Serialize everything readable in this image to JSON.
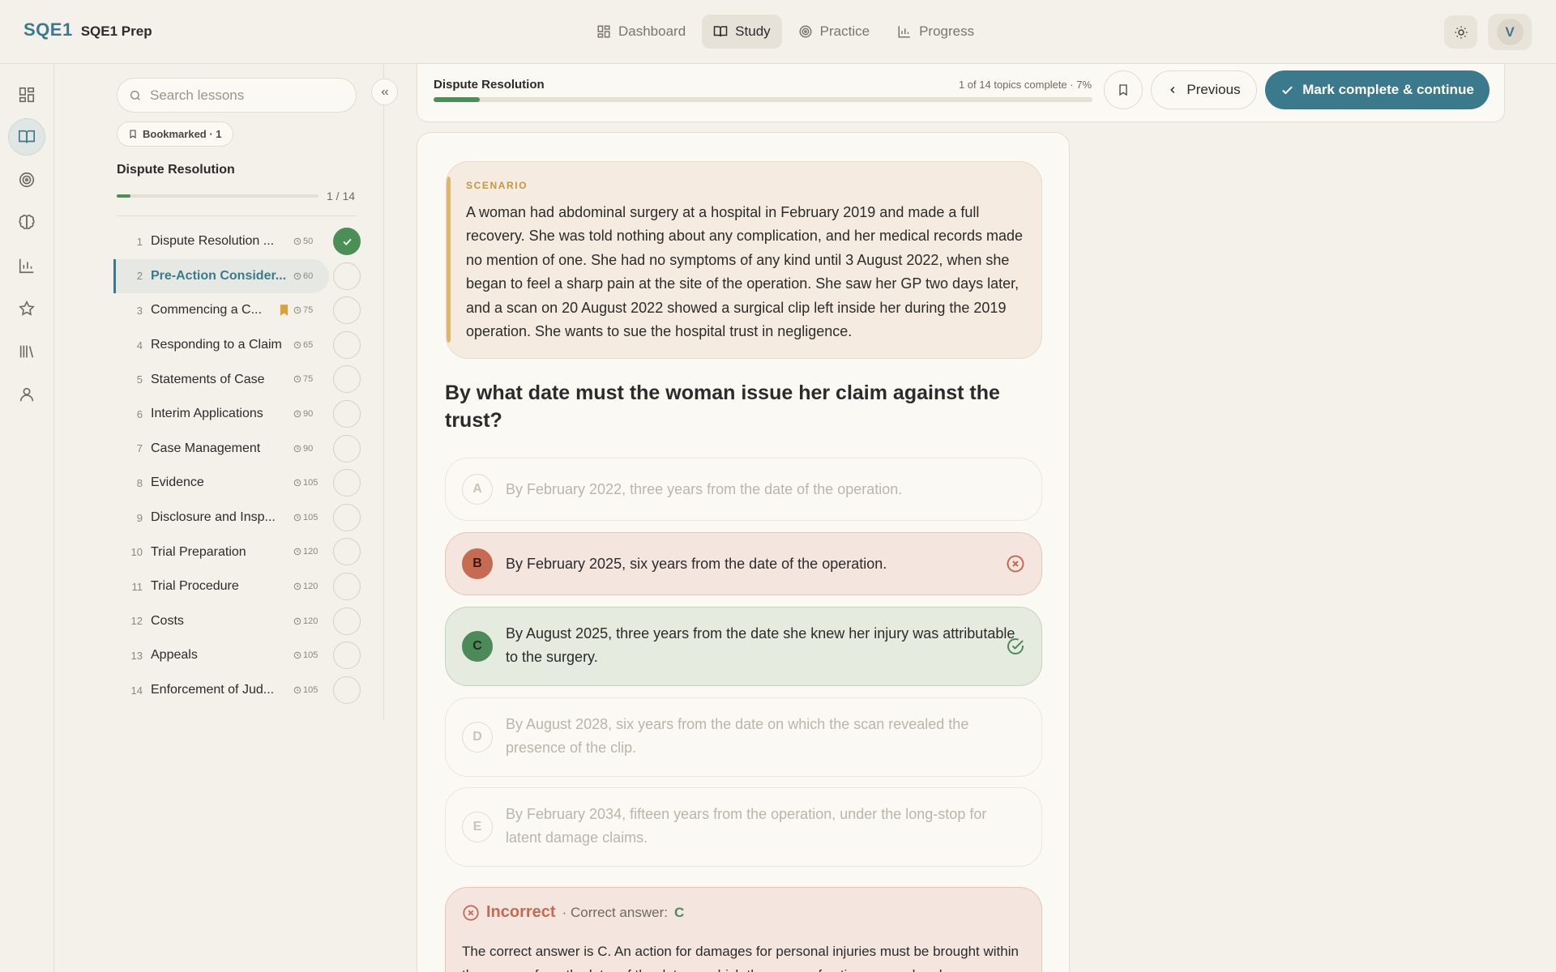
{
  "brand": {
    "mark": "SQE1",
    "name": "SQE1 Prep"
  },
  "nav": [
    {
      "label": "Dashboard",
      "icon": "dashboard-icon",
      "active": false
    },
    {
      "label": "Study",
      "icon": "book-icon",
      "active": true
    },
    {
      "label": "Practice",
      "icon": "target-icon",
      "active": false
    },
    {
      "label": "Progress",
      "icon": "chart-icon",
      "active": false
    }
  ],
  "user": {
    "initial": "V"
  },
  "rail": [
    "dashboard-icon",
    "book-icon",
    "target-icon",
    "brain-icon",
    "chart-icon",
    "star-icon",
    "library-icon",
    "user-icon"
  ],
  "sidebar": {
    "search_placeholder": "Search lessons",
    "bookmark_chip": "Bookmarked · 1",
    "section_title": "Dispute Resolution",
    "section_count": "1 / 14",
    "section_progress": 0.07,
    "lessons": [
      {
        "num": "1",
        "title": "Dispute Resolution ...",
        "time": "50",
        "done": true,
        "active": false,
        "bookmarked": false
      },
      {
        "num": "2",
        "title": "Pre-Action Consider...",
        "time": "60",
        "done": false,
        "active": true,
        "bookmarked": false
      },
      {
        "num": "3",
        "title": "Commencing a C...",
        "time": "75",
        "done": false,
        "active": false,
        "bookmarked": true
      },
      {
        "num": "4",
        "title": "Responding to a Claim",
        "time": "65",
        "done": false,
        "active": false,
        "bookmarked": false
      },
      {
        "num": "5",
        "title": "Statements of Case",
        "time": "75",
        "done": false,
        "active": false,
        "bookmarked": false
      },
      {
        "num": "6",
        "title": "Interim Applications",
        "time": "90",
        "done": false,
        "active": false,
        "bookmarked": false
      },
      {
        "num": "7",
        "title": "Case Management",
        "time": "90",
        "done": false,
        "active": false,
        "bookmarked": false
      },
      {
        "num": "8",
        "title": "Evidence",
        "time": "105",
        "done": false,
        "active": false,
        "bookmarked": false
      },
      {
        "num": "9",
        "title": "Disclosure and Insp...",
        "time": "105",
        "done": false,
        "active": false,
        "bookmarked": false
      },
      {
        "num": "10",
        "title": "Trial Preparation",
        "time": "120",
        "done": false,
        "active": false,
        "bookmarked": false
      },
      {
        "num": "11",
        "title": "Trial Procedure",
        "time": "120",
        "done": false,
        "active": false,
        "bookmarked": false
      },
      {
        "num": "12",
        "title": "Costs",
        "time": "120",
        "done": false,
        "active": false,
        "bookmarked": false
      },
      {
        "num": "13",
        "title": "Appeals",
        "time": "105",
        "done": false,
        "active": false,
        "bookmarked": false
      },
      {
        "num": "14",
        "title": "Enforcement of Jud...",
        "time": "105",
        "done": false,
        "active": false,
        "bookmarked": false
      }
    ]
  },
  "topic": {
    "title": "Dispute Resolution",
    "meta": "1 of 14 topics complete · 7%",
    "progress": 0.07,
    "prev_label": "Previous",
    "complete_label": "Mark complete & continue"
  },
  "question": {
    "scenario_label": "SCENARIO",
    "scenario": "A woman had abdominal surgery at a hospital in February 2019 and made a full recovery. She was told nothing about any complication, and her medical records made no mention of one. She had no symptoms of any kind until 3 August 2022, when she began to feel a sharp pain at the site of the operation. She saw her GP two days later, and a scan on 20 August 2022 showed a surgical clip left inside her during the 2019 operation. She wants to sue the hospital trust in negligence.",
    "prompt": "By what date must the woman issue her claim against the trust?",
    "options": [
      {
        "letter": "A",
        "text": "By February 2022, three years from the date of the operation.",
        "state": "dim"
      },
      {
        "letter": "B",
        "text": "By February 2025, six years from the date of the operation.",
        "state": "wrong"
      },
      {
        "letter": "C",
        "text": "By August 2025, three years from the date she knew her injury was attributable to the surgery.",
        "state": "right"
      },
      {
        "letter": "D",
        "text": "By August 2028, six years from the date on which the scan revealed the presence of the clip.",
        "state": "dim"
      },
      {
        "letter": "E",
        "text": "By February 2034, fifteen years from the operation, under the long-stop for latent damage claims.",
        "state": "dim"
      }
    ],
    "feedback": {
      "title": "Incorrect",
      "sep": "· Correct answer:",
      "answer": "C",
      "text": "The correct answer is C. An action for damages for personal injuries must be brought within three years from the later of the date on which the cause of action accrued and"
    }
  },
  "colors": {
    "accent": "#3b7a8c",
    "success": "#4a8f56",
    "error": "#c56b52",
    "scenario": "#e0b56e"
  }
}
